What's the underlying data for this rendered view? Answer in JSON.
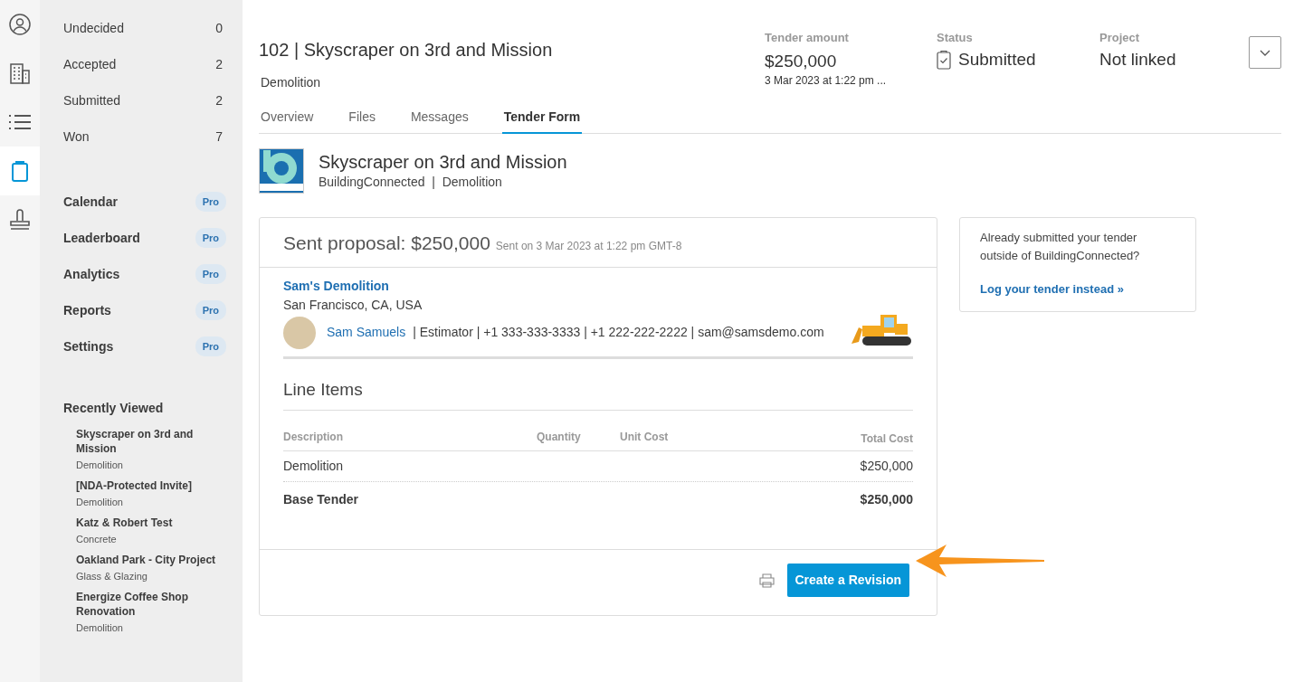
{
  "icon_rail": [
    {
      "kind": "person",
      "selected": false
    },
    {
      "kind": "building",
      "selected": false
    },
    {
      "kind": "list",
      "selected": false
    },
    {
      "kind": "clipboard",
      "selected": true
    },
    {
      "kind": "stamp",
      "selected": false
    }
  ],
  "sidebar": {
    "counts": [
      {
        "label": "Undecided",
        "count": "0"
      },
      {
        "label": "Accepted",
        "count": "2"
      },
      {
        "label": "Submitted",
        "count": "2"
      },
      {
        "label": "Won",
        "count": "7"
      }
    ],
    "features": [
      {
        "label": "Calendar",
        "badge": "Pro"
      },
      {
        "label": "Leaderboard",
        "badge": "Pro"
      },
      {
        "label": "Analytics",
        "badge": "Pro"
      },
      {
        "label": "Reports",
        "badge": "Pro"
      },
      {
        "label": "Settings",
        "badge": "Pro"
      }
    ],
    "recently_viewed": {
      "title": "Recently Viewed",
      "items": [
        {
          "name": "Skyscraper on 3rd and Mission",
          "trade": "Demolition"
        },
        {
          "name": "[NDA-Protected Invite]",
          "trade": "Demolition"
        },
        {
          "name": "Katz & Robert Test",
          "trade": "Concrete"
        },
        {
          "name": "Oakland Park - City Project",
          "trade": "Glass & Glazing"
        },
        {
          "name": "Energize Coffee Shop Renovation",
          "trade": "Demolition"
        }
      ]
    }
  },
  "header": {
    "title": "102 | Skyscraper on 3rd and Mission",
    "subtitle": "Demolition",
    "summary": [
      {
        "kind": "amount",
        "label": "Tender amount",
        "value": "$250,000",
        "note": "3 Mar 2023 at 1:22 pm ..."
      },
      {
        "kind": "status",
        "label": "Status",
        "value": "Submitted"
      },
      {
        "kind": "project",
        "label": "Project",
        "value": "Not linked"
      }
    ]
  },
  "tabs": [
    {
      "label": "Overview",
      "selected": false
    },
    {
      "label": "Files",
      "selected": false
    },
    {
      "label": "Messages",
      "selected": false
    },
    {
      "label": "Tender Form",
      "selected": true
    }
  ],
  "project": {
    "name": "Skyscraper on 3rd and Mission",
    "company": "BuildingConnected",
    "separator": "|",
    "trade": "Demolition"
  },
  "proposal": {
    "title": "Sent proposal: $250,000",
    "sent_note": "Sent on 3 Mar 2023 at 1:22 pm GMT-8",
    "company": "Sam's Demolition",
    "address": "San Francisco, CA, USA",
    "contact_name": "Sam Samuels",
    "contact_details": "| Estimator | +1 333-333-3333 | +1 222-222-2222 | sam@samsdemo.com",
    "line_items": {
      "title": "Line Items",
      "columns": [
        "Description",
        "Quantity",
        "Unit Cost",
        "Total Cost"
      ],
      "rows": [
        {
          "kind": "item",
          "description": "Demolition",
          "total": "$250,000"
        },
        {
          "kind": "total",
          "description": "Base Tender",
          "total": "$250,000"
        }
      ]
    },
    "action": "Create a Revision"
  },
  "side_card": {
    "text": "Already submitted your tender outside of BuildingConnected?",
    "link": "Log your tender instead »"
  }
}
